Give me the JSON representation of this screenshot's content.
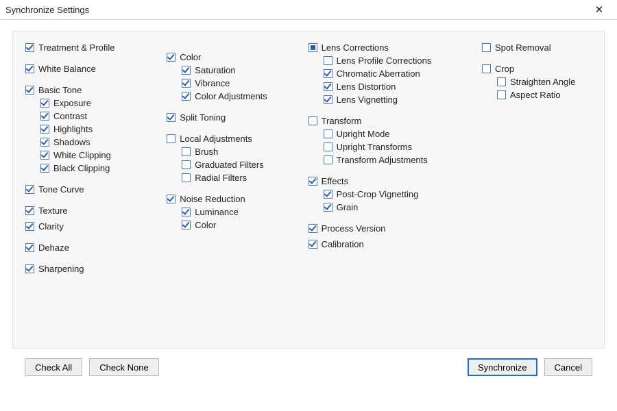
{
  "window": {
    "title": "Synchronize Settings",
    "close_glyph": "✕"
  },
  "columns": [
    [
      {
        "label": "Treatment & Profile",
        "state": "checked",
        "gap": true
      },
      {
        "label": "White Balance",
        "state": "checked",
        "gap": true
      },
      {
        "label": "Basic Tone",
        "state": "checked",
        "children": [
          {
            "label": "Exposure",
            "state": "checked"
          },
          {
            "label": "Contrast",
            "state": "checked"
          },
          {
            "label": "Highlights",
            "state": "checked"
          },
          {
            "label": "Shadows",
            "state": "checked"
          },
          {
            "label": "White Clipping",
            "state": "checked"
          },
          {
            "label": "Black Clipping",
            "state": "checked"
          }
        ],
        "gap": true
      },
      {
        "label": "Tone Curve",
        "state": "checked",
        "gap": true
      },
      {
        "label": "Texture",
        "state": "checked"
      },
      {
        "label": "Clarity",
        "state": "checked",
        "gap": true
      },
      {
        "label": "Dehaze",
        "state": "checked",
        "gap": true
      },
      {
        "label": "Sharpening",
        "state": "checked"
      }
    ],
    [
      {
        "label": "Color",
        "state": "checked",
        "children": [
          {
            "label": "Saturation",
            "state": "checked"
          },
          {
            "label": "Vibrance",
            "state": "checked"
          },
          {
            "label": "Color Adjustments",
            "state": "checked"
          }
        ],
        "gap": true,
        "leadgap": true
      },
      {
        "label": "Split Toning",
        "state": "checked",
        "gap": true
      },
      {
        "label": "Local Adjustments",
        "state": "unchecked",
        "children": [
          {
            "label": "Brush",
            "state": "unchecked"
          },
          {
            "label": "Graduated Filters",
            "state": "unchecked"
          },
          {
            "label": "Radial Filters",
            "state": "unchecked"
          }
        ],
        "gap": true
      },
      {
        "label": "Noise Reduction",
        "state": "checked",
        "children": [
          {
            "label": "Luminance",
            "state": "checked"
          },
          {
            "label": "Color",
            "state": "checked"
          }
        ]
      }
    ],
    [
      {
        "label": "Lens Corrections",
        "state": "indeterminate",
        "children": [
          {
            "label": "Lens Profile Corrections",
            "state": "unchecked"
          },
          {
            "label": "Chromatic Aberration",
            "state": "checked"
          },
          {
            "label": "Lens Distortion",
            "state": "checked"
          },
          {
            "label": "Lens Vignetting",
            "state": "checked"
          }
        ],
        "gap": true
      },
      {
        "label": "Transform",
        "state": "unchecked",
        "children": [
          {
            "label": "Upright Mode",
            "state": "unchecked"
          },
          {
            "label": "Upright Transforms",
            "state": "unchecked"
          },
          {
            "label": "Transform Adjustments",
            "state": "unchecked"
          }
        ],
        "gap": true
      },
      {
        "label": "Effects",
        "state": "checked",
        "children": [
          {
            "label": "Post-Crop Vignetting",
            "state": "checked"
          },
          {
            "label": "Grain",
            "state": "checked"
          }
        ],
        "gap": true
      },
      {
        "label": "Process Version",
        "state": "checked"
      },
      {
        "label": "Calibration",
        "state": "checked"
      }
    ],
    [
      {
        "label": "Spot Removal",
        "state": "unchecked",
        "gap": true
      },
      {
        "label": "Crop",
        "state": "unchecked",
        "children": [
          {
            "label": "Straighten Angle",
            "state": "unchecked"
          },
          {
            "label": "Aspect Ratio",
            "state": "unchecked"
          }
        ]
      }
    ]
  ],
  "buttons": {
    "check_all": "Check All",
    "check_none": "Check None",
    "synchronize": "Synchronize",
    "cancel": "Cancel"
  }
}
